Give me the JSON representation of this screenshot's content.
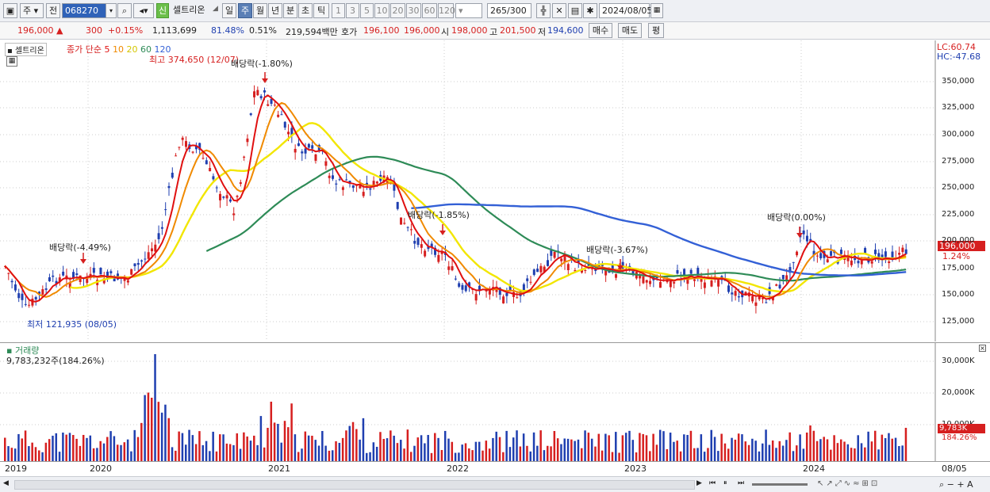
{
  "toolbar": {
    "period_jo": "주",
    "jeon": "전",
    "code": "068270",
    "sin_badge": "신",
    "stock_name": "셀트리온",
    "periods": [
      "일",
      "주",
      "월",
      "년",
      "분",
      "초",
      "틱"
    ],
    "selected_period": "주",
    "intervals": [
      "1",
      "3",
      "5",
      "10",
      "20",
      "30",
      "60",
      "120"
    ],
    "count": "265",
    "count_total": "/300",
    "date": "2024/08/05"
  },
  "quote": {
    "price": "196,000",
    "change": "300",
    "change_pct": "+0.15%",
    "volume": "1,113,699",
    "ratio": "81.48%",
    "turnover_pct": "0.51%",
    "amount": "219,594백만",
    "hoga_label": "호가",
    "bid": "196,100",
    "ask": "196,000",
    "open_label": "시",
    "open": "198,000",
    "high_label": "고",
    "high": "201,500",
    "low_label": "저",
    "low": "194,600",
    "buy_button": "매수",
    "sell_button": "매도",
    "eval_button": "평"
  },
  "price_chart": {
    "title": "셀트리온",
    "ma_legend": {
      "label": "종가 단순",
      "periods": [
        "5",
        "10",
        "20",
        "60",
        "120"
      ]
    },
    "max_note": "최고 374,650 (12/07)",
    "min_note": "최저 121,935 (08/05)",
    "lc": "LC:60.74",
    "hc": "HC:-47.68",
    "current_price": "196,000",
    "current_pct": "1.24%",
    "y_ticks": [
      "350,000",
      "325,000",
      "300,000",
      "275,000",
      "250,000",
      "225,000",
      "200,000",
      "175,000",
      "150,000",
      "125,000"
    ],
    "dividend_notes": [
      "배당락(-4.49%)",
      "배당락(-1.80%)",
      "배당락(-1.85%)",
      "배당락(-3.67%)",
      "배당락(0.00%)"
    ]
  },
  "volume_chart": {
    "title": "거래량",
    "value_note": "9,783,232주(184.26%)",
    "y_ticks": [
      "30,000K",
      "20,000K",
      "10,000K"
    ],
    "current_volume": "9,783K",
    "current_pct": "184.26%"
  },
  "x_axis": {
    "labels": [
      "2019",
      "2020",
      "2021",
      "2022",
      "2023",
      "2024"
    ],
    "end_label": "08/05"
  },
  "colors": {
    "up": "#d61f1f",
    "down": "#1f3fb0",
    "ma5": "#e01010",
    "ma10": "#f08a00",
    "ma20": "#f2e600",
    "ma60": "#2e8b57",
    "ma120": "#3360d6"
  }
}
